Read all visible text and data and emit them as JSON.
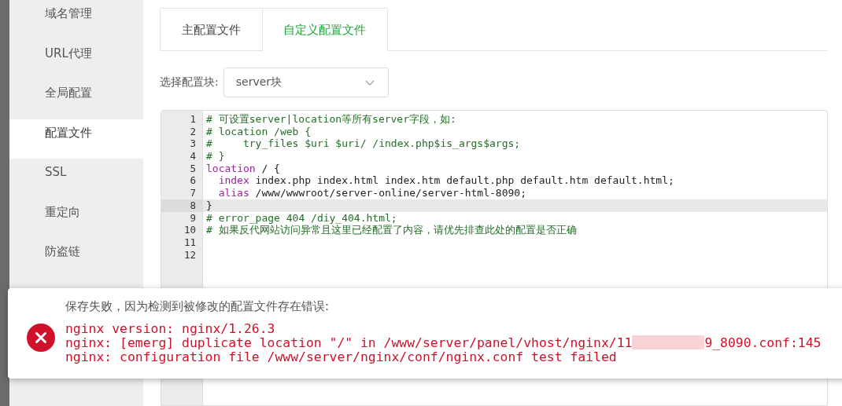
{
  "sidebar": {
    "items": [
      {
        "label": "域名管理",
        "selected": false
      },
      {
        "label": "URL代理",
        "selected": false
      },
      {
        "label": "全局配置",
        "selected": false
      },
      {
        "label": "配置文件",
        "selected": true
      },
      {
        "label": "SSL",
        "selected": false
      },
      {
        "label": "重定向",
        "selected": false
      },
      {
        "label": "防盗链",
        "selected": false
      }
    ]
  },
  "tabs": [
    {
      "label": "主配置文件",
      "selected": false
    },
    {
      "label": "自定义配置文件",
      "selected": true
    }
  ],
  "block_select": {
    "label": "选择配置块:",
    "value": "server块"
  },
  "editor": {
    "lines": [
      {
        "number": "1",
        "active": false,
        "segments": [
          {
            "kind": "comment",
            "text": "# 可设置server|location等所有server字段，如:"
          }
        ]
      },
      {
        "number": "2",
        "active": false,
        "segments": [
          {
            "kind": "comment",
            "text": "# location /web {"
          }
        ]
      },
      {
        "number": "3",
        "active": false,
        "segments": [
          {
            "kind": "comment",
            "text": "#     try_files $uri $uri/ /index.php$is_args$args;"
          }
        ]
      },
      {
        "number": "4",
        "active": false,
        "segments": [
          {
            "kind": "comment",
            "text": "# }"
          }
        ]
      },
      {
        "number": "5",
        "active": false,
        "segments": [
          {
            "kind": "keyword",
            "text": "location"
          },
          {
            "kind": "plain",
            "text": " / {"
          }
        ]
      },
      {
        "number": "6",
        "active": false,
        "indented": true,
        "segments": [
          {
            "kind": "keyword",
            "text": "index"
          },
          {
            "kind": "plain",
            "text": " index.php index.html index.htm default.php default.htm default.html;"
          }
        ]
      },
      {
        "number": "7",
        "active": false,
        "indented": true,
        "segments": [
          {
            "kind": "keyword",
            "text": "alias"
          },
          {
            "kind": "plain",
            "text": " /www/wwwroot/server-online/server-html-8090;"
          }
        ]
      },
      {
        "number": "8",
        "active": true,
        "segments": [
          {
            "kind": "plain",
            "text": "}"
          }
        ]
      },
      {
        "number": "9",
        "active": false,
        "segments": [
          {
            "kind": "comment",
            "text": "# error_page 404 /diy_404.html;"
          }
        ]
      },
      {
        "number": "10",
        "active": false,
        "segments": [
          {
            "kind": "comment",
            "text": "# 如果反代网站访问异常且这里已经配置了内容，请优先排查此处的配置是否正确"
          }
        ]
      },
      {
        "number": "11",
        "active": false
      },
      {
        "number": "12",
        "active": false
      }
    ]
  },
  "toast": {
    "kind": "error",
    "title": "保存失败，因为检测到被修改的配置文件存在错误:",
    "lines": [
      {
        "parts": [
          "nginx version: nginx/1.26.3"
        ]
      },
      {
        "parts": [
          "nginx: [emerg] duplicate location \"/\" in /www/server/panel/vhost/nginx/11",
          "9_8090.conf:145"
        ]
      },
      {
        "parts": [
          "nginx: configuration file /www/server/nginx/conf/nginx.conf test failed"
        ]
      }
    ]
  }
}
